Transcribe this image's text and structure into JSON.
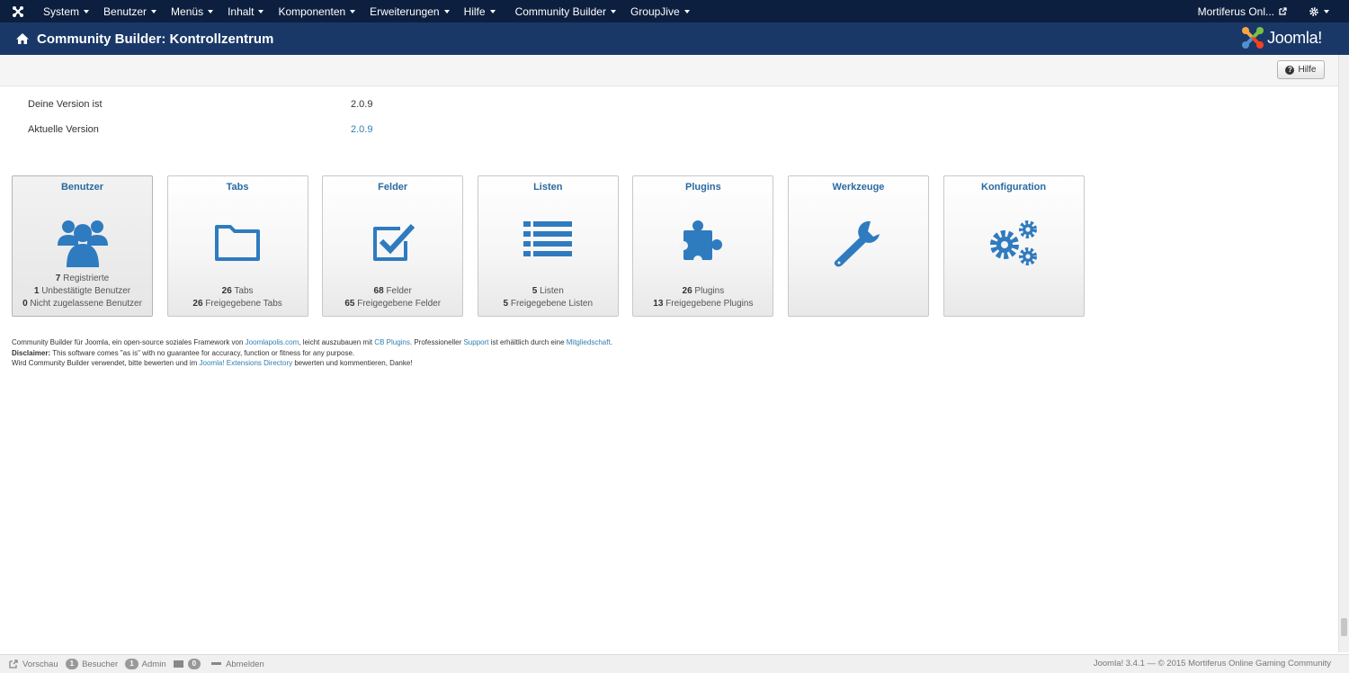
{
  "navbar": {
    "menu": [
      {
        "label": "System"
      },
      {
        "label": "Benutzer"
      },
      {
        "label": "Menüs"
      },
      {
        "label": "Inhalt"
      },
      {
        "label": "Komponenten"
      },
      {
        "label": "Erweiterungen"
      },
      {
        "label": "Hilfe"
      },
      {
        "label": "Community Builder"
      },
      {
        "label": "GroupJive"
      }
    ],
    "site_name": "Mortiferus Onl..."
  },
  "header": {
    "title": "Community Builder: Kontrollzentrum",
    "brand": "Joomla!"
  },
  "toolbar": {
    "help_label": "Hilfe"
  },
  "version": {
    "your_label": "Deine Version ist",
    "your_value": "2.0.9",
    "latest_label": "Aktuelle Version",
    "latest_value": "2.0.9"
  },
  "tiles": [
    {
      "title": "Benutzer",
      "icon": "users-icon",
      "stats": [
        [
          "7",
          "Registrierte"
        ],
        [
          "1",
          "Unbestätigte Benutzer"
        ],
        [
          "0",
          "Nicht zugelassene Benutzer"
        ]
      ]
    },
    {
      "title": "Tabs",
      "icon": "folder-icon",
      "stats": [
        [
          "26",
          "Tabs"
        ],
        [
          "26",
          "Freigegebene Tabs"
        ]
      ]
    },
    {
      "title": "Felder",
      "icon": "checkbox-icon",
      "stats": [
        [
          "68",
          "Felder"
        ],
        [
          "65",
          "Freigegebene Felder"
        ]
      ]
    },
    {
      "title": "Listen",
      "icon": "list-icon",
      "stats": [
        [
          "5",
          "Listen"
        ],
        [
          "5",
          "Freigegebene Listen"
        ]
      ]
    },
    {
      "title": "Plugins",
      "icon": "puzzle-icon",
      "stats": [
        [
          "26",
          "Plugins"
        ],
        [
          "13",
          "Freigegebene Plugins"
        ]
      ]
    },
    {
      "title": "Werkzeuge",
      "icon": "wrench-icon",
      "stats": []
    },
    {
      "title": "Konfiguration",
      "icon": "gears-icon",
      "stats": []
    }
  ],
  "credits": {
    "l1_a": "Community Builder für Joomla, ein open-source soziales Framework von ",
    "l1_link1": "Joomlapolis.com",
    "l1_b": ", leicht auszubauen mit ",
    "l1_link2": "CB Plugins",
    "l1_c": ". Professioneller ",
    "l1_link3": "Support",
    "l1_d": " ist erhältlich durch eine ",
    "l1_link4": "Mitgliedschaft",
    "l1_e": ".",
    "l2_bold": "Disclaimer:",
    "l2_text": " This software comes \"as is\" with no guarantee for accuracy, function or fitness for any purpose.",
    "l3_a": "Wird Community Builder verwendet, bitte bewerten und im ",
    "l3_link": "Joomla! Extensions Directory",
    "l3_b": " bewerten und kommentieren, Danke!"
  },
  "statusbar": {
    "preview": "Vorschau",
    "visitors_count": "1",
    "visitors_label": "Besucher",
    "admin_count": "1",
    "admin_label": "Admin",
    "messages_count": "0",
    "logout": "Abmelden",
    "copyright": "Joomla! 3.4.1  —  © 2015 Mortiferus Online Gaming Community"
  },
  "colors": {
    "navbar": "#0d1f3f",
    "header": "#1a3867",
    "icon_blue": "#2f7bbf",
    "title_blue": "#2a6aa1"
  }
}
